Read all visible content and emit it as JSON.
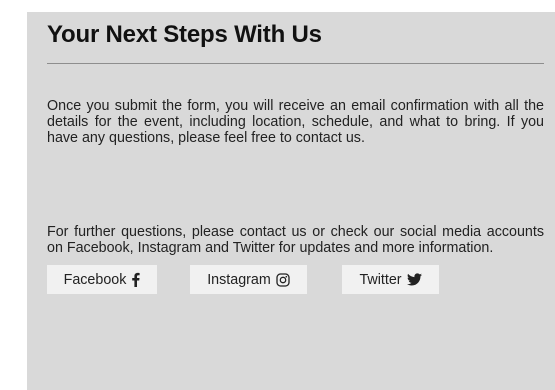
{
  "section": {
    "title": "Your Next Steps With Us",
    "paragraph_1": "Once you submit the form, you will receive an email confirmation with all the details for the event, including location, schedule, and what to bring. If you have any questions, please feel free to contact us.",
    "paragraph_2": "For further questions, please contact us or check our social media accounts on Facebook, Instagram and Twitter for updates and more information."
  },
  "socials": {
    "facebook_label": "Facebook",
    "facebook_icon": "facebook-icon",
    "instagram_label": "Instagram",
    "instagram_icon": "instagram-icon",
    "twitter_label": "Twitter",
    "twitter_icon": "twitter-icon"
  },
  "colors": {
    "panel_background": "#d9d9d9",
    "button_background": "#f1f1f1",
    "heading_text": "#111111",
    "body_text": "#222222",
    "divider": "#8e8e8e"
  }
}
